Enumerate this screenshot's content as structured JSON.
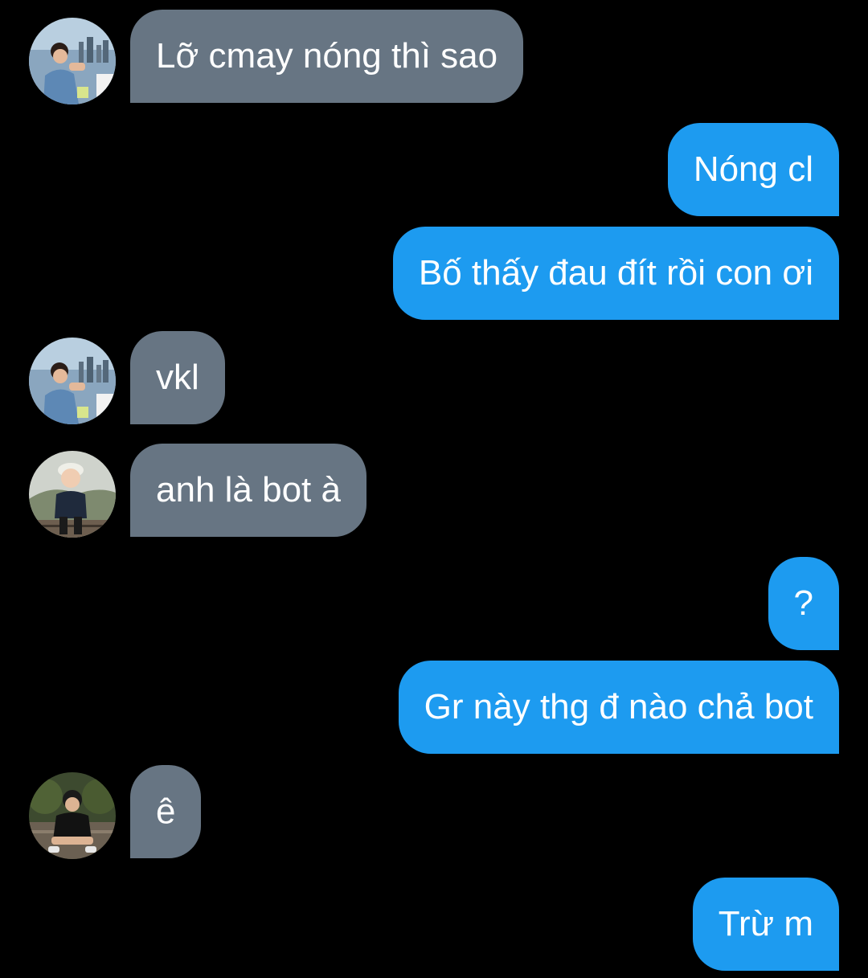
{
  "colors": {
    "background": "#000000",
    "incoming_bubble": "#677583",
    "outgoing_bubble": "#1d9bf0",
    "text": "#ffffff"
  },
  "messages": [
    {
      "direction": "incoming",
      "text": "Lỡ cmay nóng thì sao",
      "avatar": "avatar-city-guy"
    },
    {
      "direction": "outgoing",
      "text": "Nóng cl"
    },
    {
      "direction": "outgoing",
      "text": "Bố thấy đau đít rồi con ơi"
    },
    {
      "direction": "incoming",
      "text": "vkl",
      "avatar": "avatar-city-guy"
    },
    {
      "direction": "incoming",
      "text": "anh là bot à",
      "avatar": "avatar-child-cap"
    },
    {
      "direction": "outgoing",
      "text": "?"
    },
    {
      "direction": "outgoing",
      "text": "Gr này thg đ nào chả bot"
    },
    {
      "direction": "incoming",
      "text": "ê",
      "avatar": "avatar-sitting-guy"
    },
    {
      "direction": "outgoing",
      "text": "Trừ m"
    }
  ]
}
